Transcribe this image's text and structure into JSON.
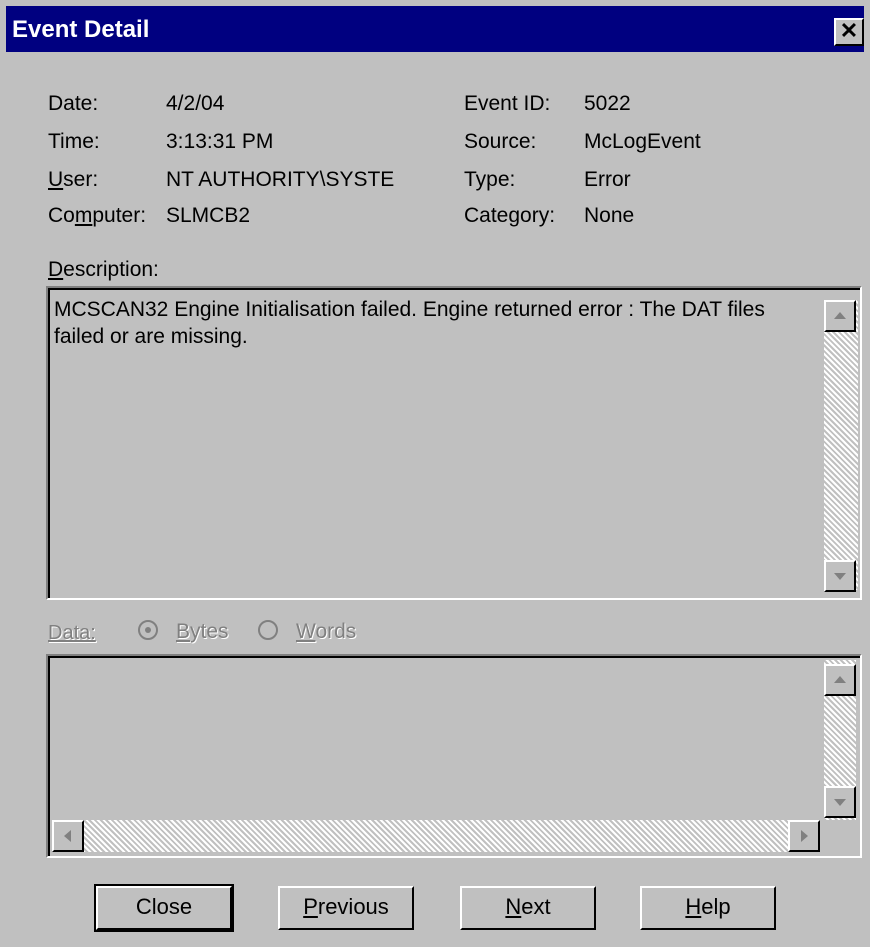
{
  "window": {
    "title": "Event Detail",
    "close_glyph": "✕"
  },
  "fields": {
    "date_label": "Date:",
    "date_value": "4/2/04",
    "time_label": "Time:",
    "time_value": "3:13:31 PM",
    "user_label_u": "U",
    "user_label_rest": "ser:",
    "user_value": "NT AUTHORITY\\SYSTE",
    "computer_label_a": "Co",
    "computer_label_u": "m",
    "computer_label_b": "puter:",
    "computer_value": "SLMCB2",
    "event_id_label": "Event ID:",
    "event_id_value": "5022",
    "source_label": "Source:",
    "source_value": "McLogEvent",
    "type_label": "Type:",
    "type_value": "Error",
    "category_label": "Category:",
    "category_value": "None"
  },
  "description": {
    "label_u": "D",
    "label_rest": "escription:",
    "text": "MCSCAN32 Engine Initialisation failed. Engine returned error : The DAT files failed or are missing."
  },
  "data_section": {
    "label": "Data:",
    "bytes_u": "B",
    "bytes_rest": "ytes",
    "words_u": "W",
    "words_rest": "ords",
    "selected": "Bytes"
  },
  "buttons": {
    "close": "Close",
    "previous_u": "P",
    "previous_rest": "revious",
    "next_u": "N",
    "next_rest": "ext",
    "help_u": "H",
    "help_rest": "elp"
  },
  "colors": {
    "titlebar": "#000080",
    "face": "#c0c0c0",
    "disabled": "#808080"
  }
}
